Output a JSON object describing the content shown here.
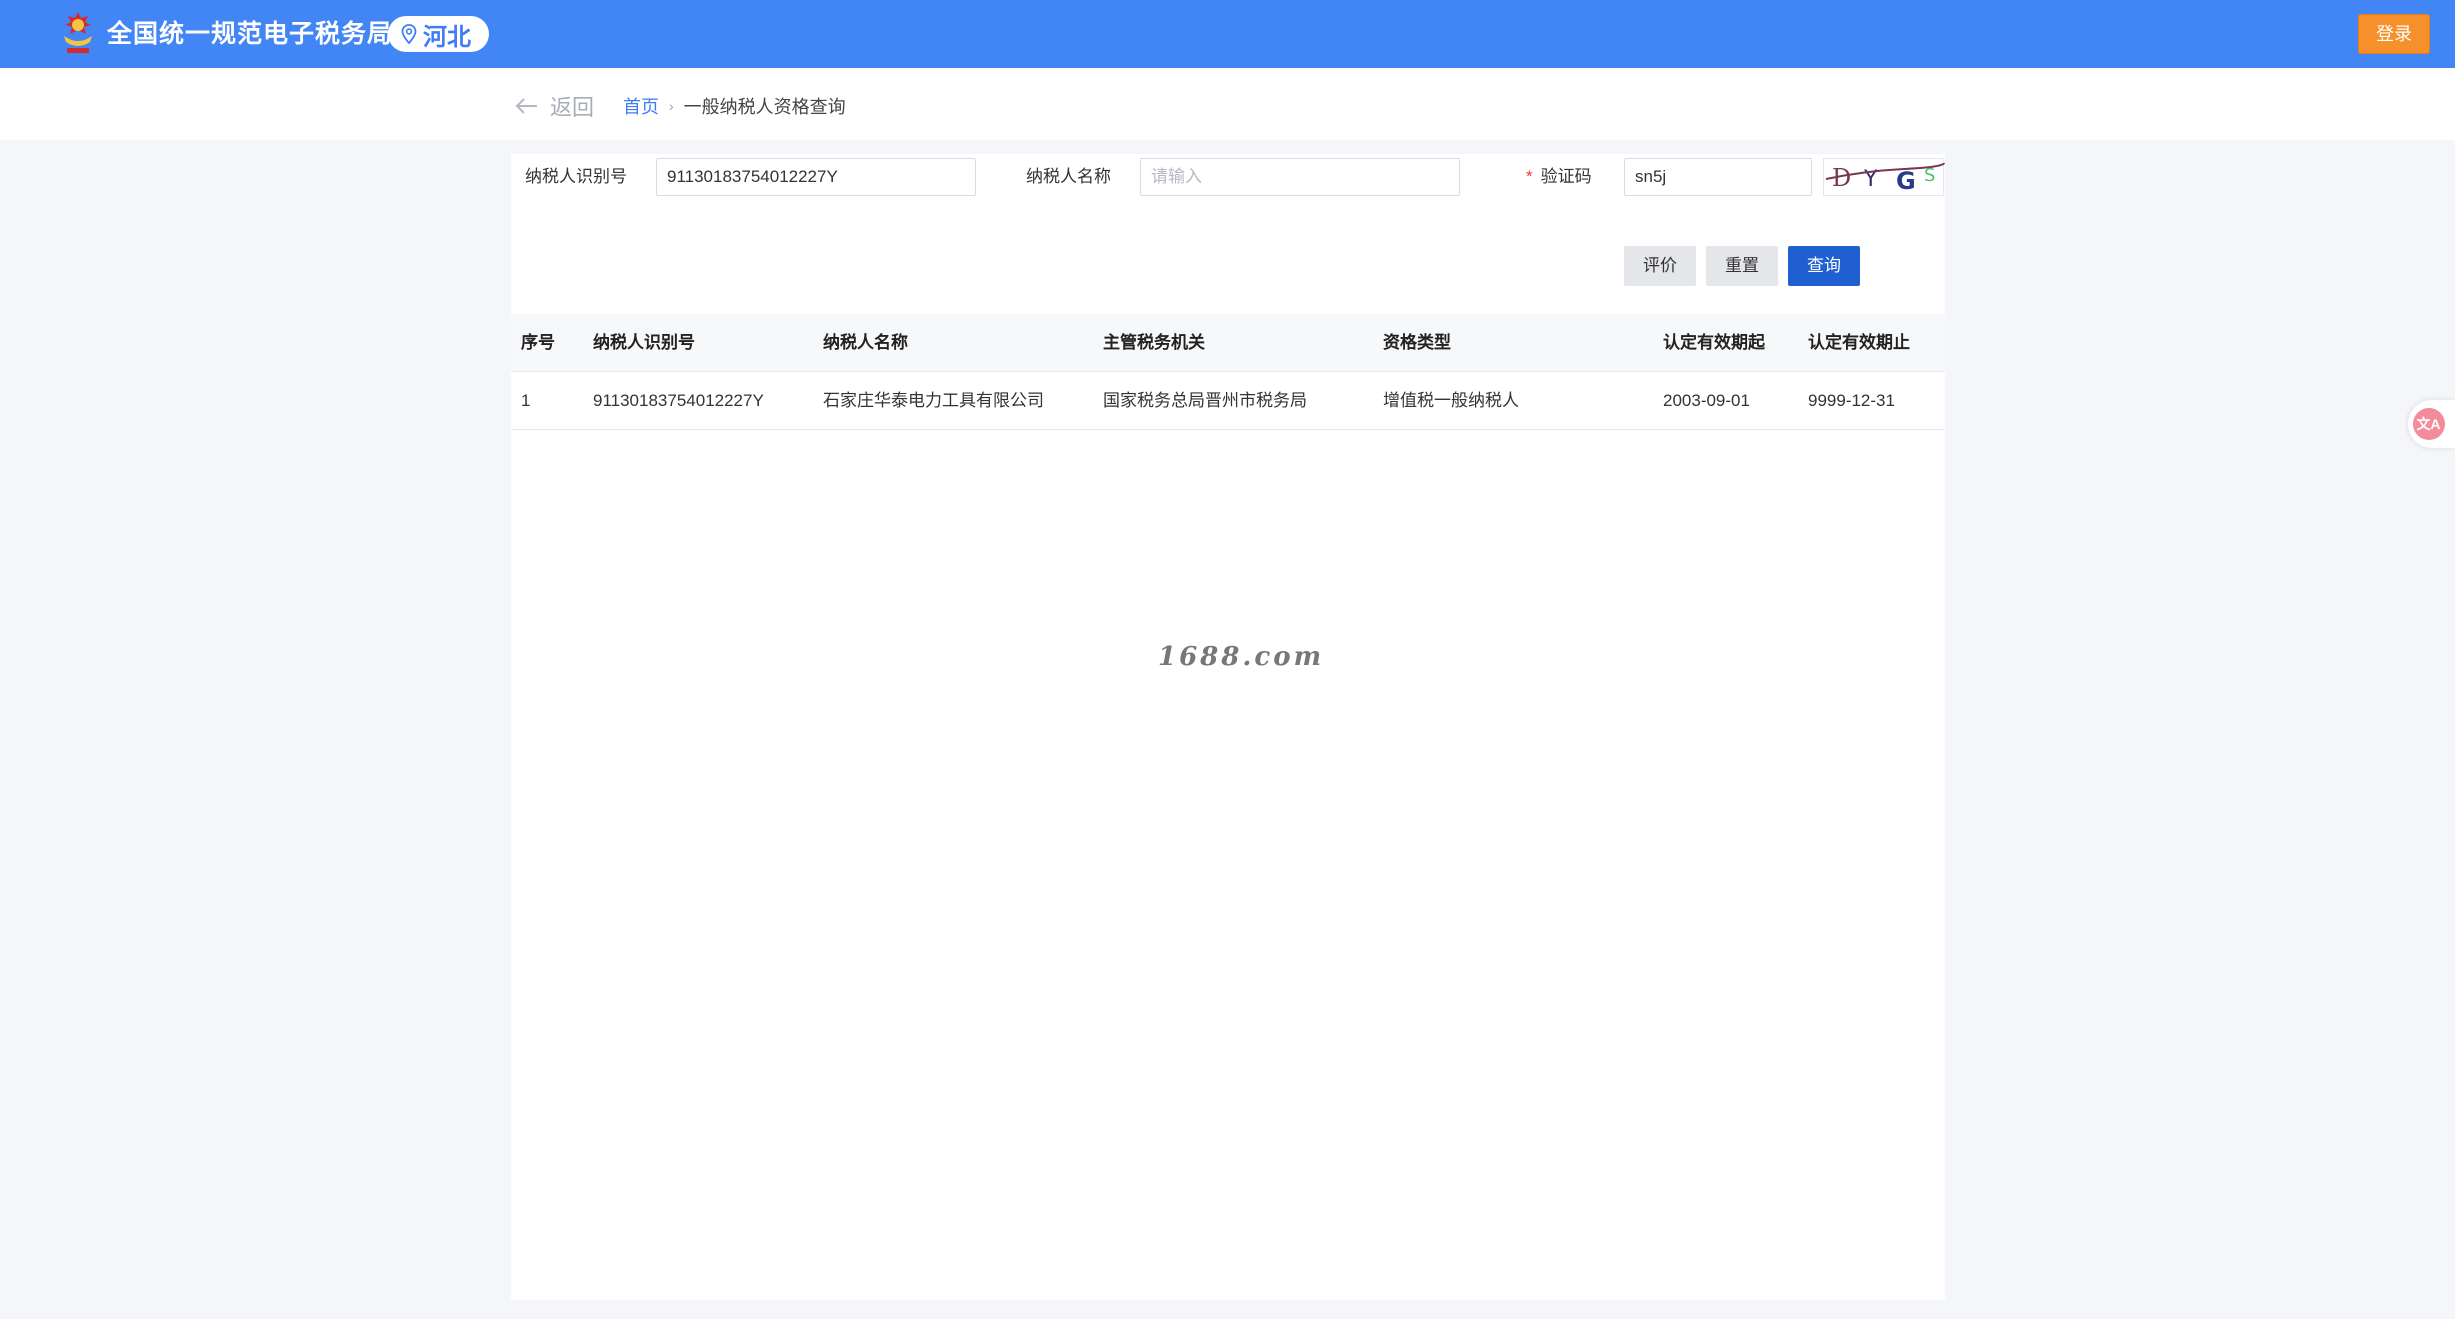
{
  "header": {
    "site_title": "全国统一规范电子税务局",
    "region": "河北",
    "login_label": "登录"
  },
  "breadcrumb": {
    "back_label": "返回",
    "home_label": "首页",
    "separator": "›",
    "current_label": "一般纳税人资格查询"
  },
  "search_form": {
    "taxpayer_id_label": "纳税人识别号",
    "taxpayer_id_value": "91130183754012227Y",
    "taxpayer_name_label": "纳税人名称",
    "taxpayer_name_placeholder": "请输入",
    "captcha_required_mark": "*",
    "captcha_label": "验证码",
    "captcha_value": "sn5j",
    "captcha_image_text": "DYGS",
    "evaluate_label": "评价",
    "reset_label": "重置",
    "query_label": "查询"
  },
  "table": {
    "columns": [
      "序号",
      "纳税人识别号",
      "纳税人名称",
      "主管税务机关",
      "资格类型",
      "认定有效期起",
      "认定有效期止"
    ],
    "rows": [
      [
        "1",
        "91130183754012227Y",
        "石家庄华泰电力工具有限公司",
        "国家税务总局晋州市税务局",
        "增值税一般纳税人",
        "2003-09-01",
        "9999-12-31"
      ]
    ]
  },
  "watermark": "1688.com",
  "side_widget": {
    "label": "文A"
  },
  "colors": {
    "header_bg": "#4285f4",
    "login_button": "#f5902a",
    "primary_button": "#1f5fd1",
    "link": "#3f7cf5",
    "required": "#e23a3a"
  }
}
